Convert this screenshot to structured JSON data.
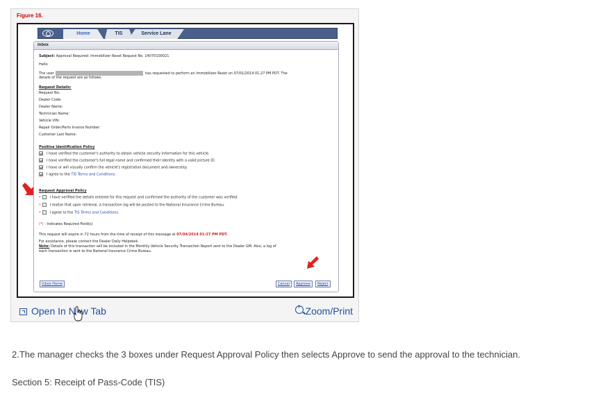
{
  "figure": {
    "label": "Figure 16.",
    "nav": {
      "tabs": [
        "Home",
        "TIS",
        "Service Lane"
      ]
    },
    "inbox": {
      "header": "Inbox",
      "subject_label": "Subject:",
      "subject": "Approval Required: Immobilizer Reset Request No. 14070100021",
      "greeting": "Hello",
      "intro_prefix": "The user",
      "intro_suffix": "has requested to perform an Immobilizer Reset on 07/01/2014 01:27 PM PDT. The",
      "intro_line2": "details of the request are as follows.",
      "request_details": {
        "heading": "Request Details:",
        "fields": [
          "Request No:",
          "Dealer Code:",
          "Dealer Name:",
          "Technician Name:",
          "Vehicle VIN:",
          "Repair Order/Parts Invoice Number:",
          "Customer Last Name:"
        ]
      },
      "positive_id": {
        "heading": "Positive Identification Policy",
        "items": [
          "I have verified the customer's authority to obtain vehicle security information for this vehicle.",
          "I have verified the customer's full legal name and confirmed their identity with a valid picture ID.",
          "I have or will visually confirm the vehicle's registration document and ownership."
        ],
        "terms_prefix": "I agree to the",
        "terms_link": "TIS Terms and Conditions."
      },
      "approval_policy": {
        "heading": "Request Approval Policy",
        "star": "*",
        "items": [
          "I have verified the details entered for this request and confirmed the authority of the customer was verified.",
          "I realize that upon retrieval, a transaction log will be posted to the National Insurance Crime Bureau."
        ],
        "terms_prefix": "I agree to the",
        "terms_link": "TIS Terms and Conditions."
      },
      "required_note": "(*) - Indicates Required Field(s)",
      "required_star": "(*)",
      "required_text": "- Indicates Required Field(s)",
      "expiry_prefix": "This request will expire in 72 hours from the time of receipt of this message at",
      "expiry_time": "07/04/2014 01:27 PM PDT.",
      "assistance": "For assistance, please contact the Dealer Daily Helpdesk.",
      "note_label": "Note:",
      "note_text": "Details of this transaction will be included in the Monthly Vehicle Security Transaction Report sent to the Dealer GM. Also, a log of",
      "note_line2": "each transaction is sent to the National Insurance Crime Bureau.",
      "buttons": {
        "inbox_home": "Inbox Home",
        "cancel": "Cancel",
        "approve": "Approve",
        "reject": "Reject"
      }
    },
    "footer": {
      "open_tab": "Open In New Tab",
      "zoom": "Zoom/Print"
    }
  },
  "caption": "2.The manager checks the 3 boxes under Request Approval Policy then selects Approve to send the approval to the technician.",
  "section": "Section 5: Receipt of Pass-Code (TIS)",
  "colors": {
    "accent_red": "#d00000",
    "link_blue": "#1f4f9c",
    "nav_bg": "#4a5f8c"
  },
  "icons": [
    "toyota-logo-icon",
    "checkbox-icon",
    "red-arrow-icon",
    "open-new-tab-icon",
    "zoom-icon",
    "hand-cursor-icon"
  ]
}
